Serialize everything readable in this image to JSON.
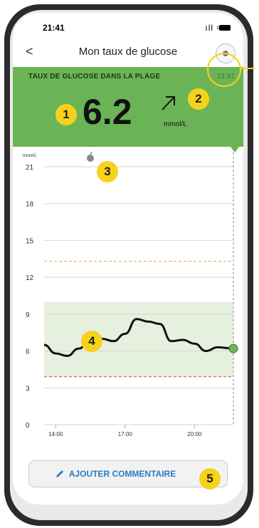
{
  "status_bar": {
    "time": "21:41"
  },
  "nav": {
    "title": "Mon taux de glucose"
  },
  "banner": {
    "label": "TAUX DE GLUCOSE DANS LA PLAGE",
    "time": "21:41",
    "value": "6.2",
    "unit": "mmol/L",
    "trend": "rising-diagonal",
    "color": "#6bb456"
  },
  "chart": {
    "unit_label": "mmol/L",
    "y_ticks": [
      "21",
      "18",
      "15",
      "12",
      "9",
      "6",
      "3",
      "0"
    ],
    "x_ticks": [
      "14:00",
      "17:00",
      "20:00"
    ],
    "high_threshold": 13.3,
    "low_threshold": 3.9,
    "target_range": [
      3.9,
      10.0
    ]
  },
  "chart_data": {
    "type": "line",
    "ylabel": "mmol/L",
    "ylim": [
      0,
      21
    ],
    "x": [
      "13:30",
      "14:00",
      "14:30",
      "15:00",
      "15:30",
      "16:00",
      "16:30",
      "17:00",
      "17:30",
      "18:00",
      "18:30",
      "19:00",
      "19:30",
      "20:00",
      "20:30",
      "21:00",
      "21:41"
    ],
    "series": [
      {
        "values": [
          6.5,
          5.8,
          5.6,
          6.2,
          6.9,
          7.0,
          6.8,
          7.4,
          8.6,
          8.4,
          8.2,
          6.8,
          6.9,
          6.6,
          6.0,
          6.3,
          6.2
        ]
      }
    ],
    "meal_marker": {
      "x": "15:30",
      "icon": "apple-icon"
    },
    "grid": true
  },
  "callouts": [
    "1",
    "2",
    "3",
    "4",
    "5"
  ],
  "actions": {
    "comment_label": "AJOUTER COMMENTAIRE"
  },
  "colors": {
    "accent": "#f6d21c",
    "link": "#2b7bc8",
    "curve": "#111111",
    "range_fill": "#e6f0df",
    "high_line": "#f0a050",
    "low_line": "#e04040"
  }
}
